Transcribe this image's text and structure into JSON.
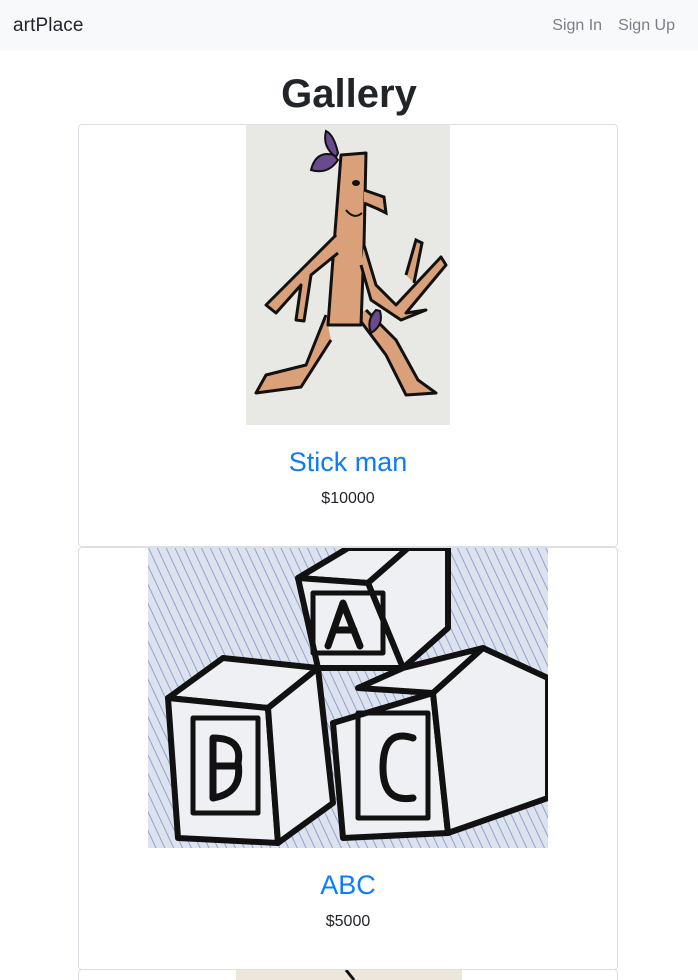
{
  "nav": {
    "brand": "artPlace",
    "links": [
      "Sign In",
      "Sign Up"
    ]
  },
  "page": {
    "title": "Gallery"
  },
  "artworks": [
    {
      "title": "Stick man",
      "price": "$10000",
      "image_subject": "stick-man-drawing"
    },
    {
      "title": "ABC",
      "price": "$5000",
      "image_subject": "abc-blocks-drawing"
    },
    {
      "title": "",
      "price": "",
      "image_subject": "drawing"
    }
  ],
  "colors": {
    "navbar_bg": "#f8f9fa",
    "link": "#0d7bff",
    "muted": "#7a7f85"
  }
}
